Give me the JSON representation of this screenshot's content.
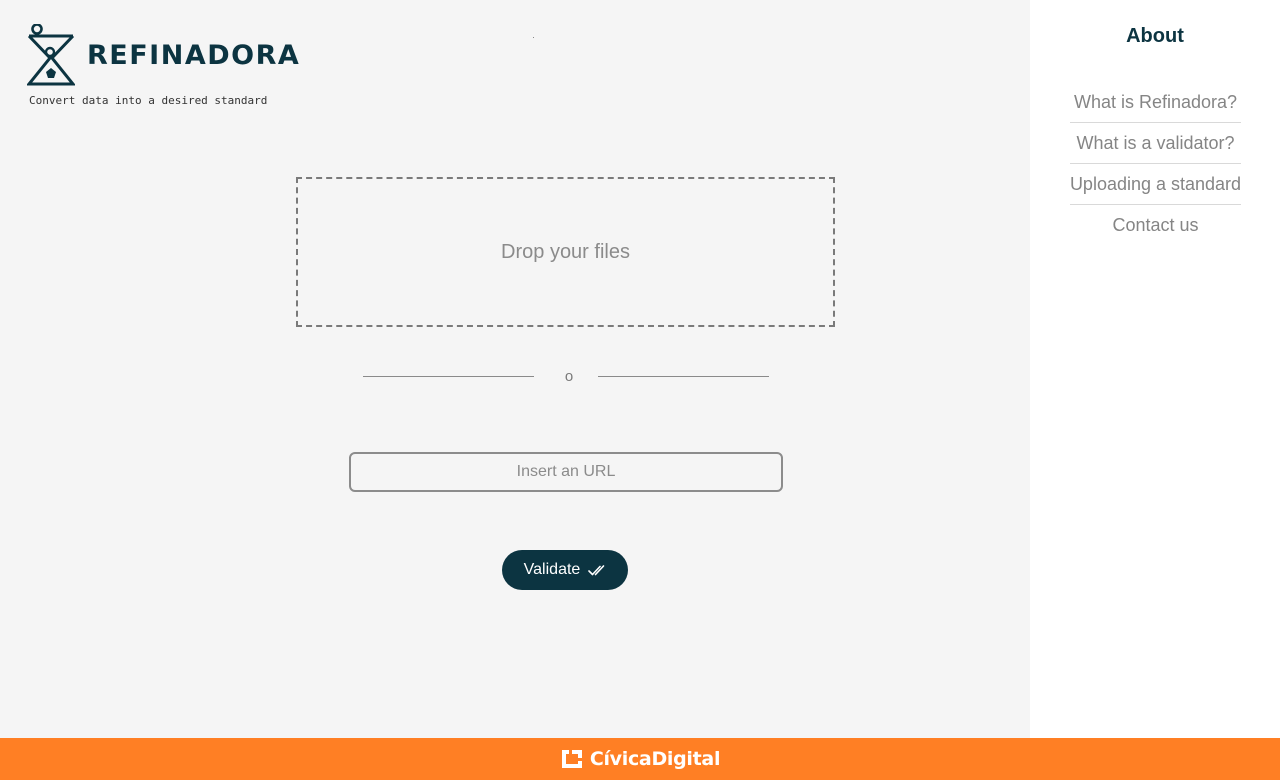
{
  "brand": {
    "name": "REFINADORA",
    "tagline": "Convert data into a desired standard"
  },
  "upload": {
    "dropzone_label": "Drop your files",
    "divider_text": "o",
    "url_placeholder": "Insert an URL",
    "url_value": "",
    "validate_label": "Validate"
  },
  "sidebar": {
    "title": "About",
    "items": [
      {
        "label": "What is Refinadora?"
      },
      {
        "label": "What is a validator?"
      },
      {
        "label": "Uploading a standard"
      },
      {
        "label": "Contact us"
      }
    ]
  },
  "footer": {
    "brand": "CívicaDigital"
  },
  "colors": {
    "primary": "#0c3441",
    "footer_bg": "#ff7f24",
    "main_bg": "#f5f5f5",
    "sidebar_bg": "#ffffff",
    "muted_text": "#858585"
  },
  "icons": {
    "logo": "hourglass-logo-icon",
    "validate": "double-check-icon",
    "footer": "civica-digital-logo-icon"
  }
}
